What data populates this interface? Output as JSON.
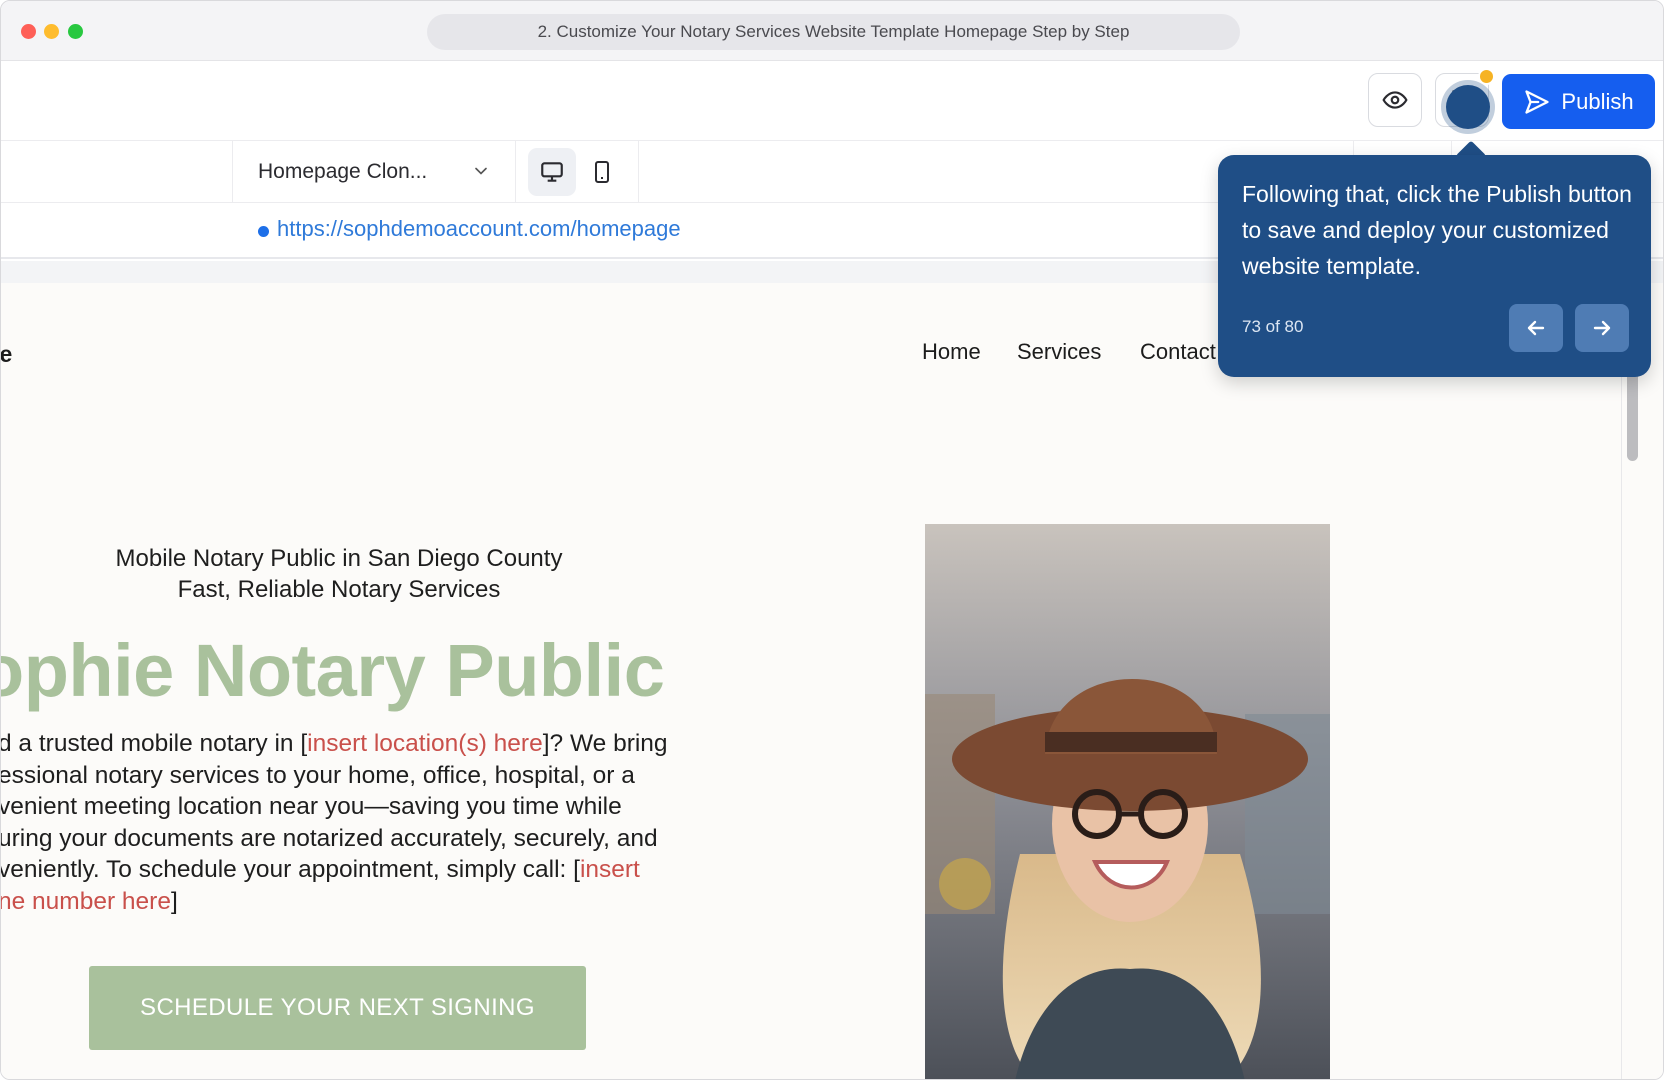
{
  "window": {
    "title": "2. Customize Your Notary Services Website Template Homepage Step by Step"
  },
  "toolbar": {
    "preview_icon": "eye-icon",
    "save_icon": "save-icon",
    "publish_label": "Publish",
    "publish_icon": "send-icon",
    "accent": "#155eef"
  },
  "subbar": {
    "page_selected": "Homepage Clon...",
    "devices": [
      "desktop-icon",
      "mobile-icon"
    ]
  },
  "urlbar": {
    "url": "https://sophdemoaccount.com/homepage"
  },
  "site": {
    "logo_fragment": "me",
    "nav": [
      "Home",
      "Services",
      "Contact"
    ],
    "tagline_line1": "Mobile Notary Public in San Diego County",
    "tagline_line2": "Fast, Reliable Notary Services",
    "title": "ophie Notary Public",
    "body": {
      "l1_a": "d a trusted mobile notary in [",
      "l1_ph": "insert location(s) here",
      "l1_b": "]? We bring",
      "l2": "essional notary services to your home, office, hospital, or a",
      "l3": "venient meeting location near you—saving you time while",
      "l4": "uring your documents are notarized accurately, securely, and",
      "l5_a": "veniently. To schedule your appointment, simply call: [",
      "l5_ph": "insert",
      "l6_ph": "ne number here",
      "l6_b": "]"
    },
    "cta_label": "SCHEDULE YOUR NEXT SIGNING",
    "accent_green": "#a9c19c",
    "placeholder_red": "#c9504b"
  },
  "tooltip": {
    "text": "Following that, click the Publish button to save and deploy your customized website template.",
    "counter": "73 of 80",
    "prev_icon": "arrow-left-icon",
    "next_icon": "arrow-right-icon",
    "color": "#1f4e86"
  }
}
